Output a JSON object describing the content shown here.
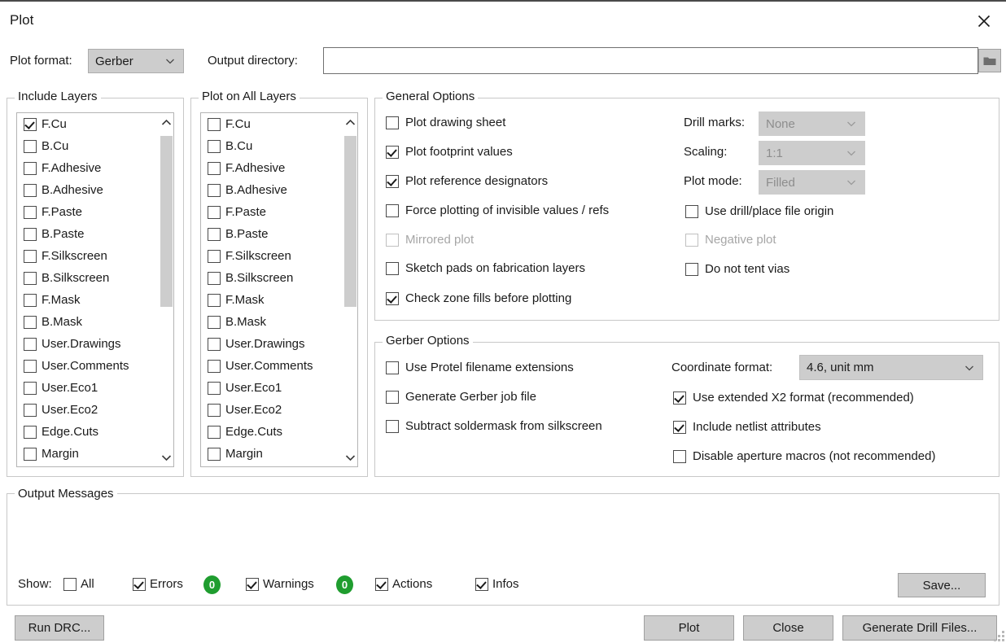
{
  "window": {
    "title": "Plot",
    "close_icon": "close-icon"
  },
  "top": {
    "plot_format_label": "Plot format:",
    "plot_format_value": "Gerber",
    "output_dir_label": "Output directory:",
    "output_dir_value": "",
    "output_dir_placeholder": "",
    "browse_icon": "folder-icon"
  },
  "include_layers": {
    "title": "Include Layers",
    "items": [
      {
        "label": "F.Cu",
        "checked": true
      },
      {
        "label": "B.Cu",
        "checked": false
      },
      {
        "label": "F.Adhesive",
        "checked": false
      },
      {
        "label": "B.Adhesive",
        "checked": false
      },
      {
        "label": "F.Paste",
        "checked": false
      },
      {
        "label": "B.Paste",
        "checked": false
      },
      {
        "label": "F.Silkscreen",
        "checked": false
      },
      {
        "label": "B.Silkscreen",
        "checked": false
      },
      {
        "label": "F.Mask",
        "checked": false
      },
      {
        "label": "B.Mask",
        "checked": false
      },
      {
        "label": "User.Drawings",
        "checked": false
      },
      {
        "label": "User.Comments",
        "checked": false
      },
      {
        "label": "User.Eco1",
        "checked": false
      },
      {
        "label": "User.Eco2",
        "checked": false
      },
      {
        "label": "Edge.Cuts",
        "checked": false
      },
      {
        "label": "Margin",
        "checked": false
      }
    ]
  },
  "plot_on_all_layers": {
    "title": "Plot on All Layers",
    "items": [
      {
        "label": "F.Cu",
        "checked": false
      },
      {
        "label": "B.Cu",
        "checked": false
      },
      {
        "label": "F.Adhesive",
        "checked": false
      },
      {
        "label": "B.Adhesive",
        "checked": false
      },
      {
        "label": "F.Paste",
        "checked": false
      },
      {
        "label": "B.Paste",
        "checked": false
      },
      {
        "label": "F.Silkscreen",
        "checked": false
      },
      {
        "label": "B.Silkscreen",
        "checked": false
      },
      {
        "label": "F.Mask",
        "checked": false
      },
      {
        "label": "B.Mask",
        "checked": false
      },
      {
        "label": "User.Drawings",
        "checked": false
      },
      {
        "label": "User.Comments",
        "checked": false
      },
      {
        "label": "User.Eco1",
        "checked": false
      },
      {
        "label": "User.Eco2",
        "checked": false
      },
      {
        "label": "Edge.Cuts",
        "checked": false
      },
      {
        "label": "Margin",
        "checked": false
      }
    ]
  },
  "general_options": {
    "title": "General Options",
    "checkboxes": [
      {
        "label": "Plot drawing sheet",
        "checked": false,
        "enabled": true
      },
      {
        "label": "Plot footprint values",
        "checked": true,
        "enabled": true
      },
      {
        "label": "Plot reference designators",
        "checked": true,
        "enabled": true
      },
      {
        "label": "Force plotting of invisible values / refs",
        "checked": false,
        "enabled": true
      },
      {
        "label": "Mirrored plot",
        "checked": false,
        "enabled": false
      },
      {
        "label": "Sketch pads on fabrication layers",
        "checked": false,
        "enabled": true
      },
      {
        "label": "Check zone fills before plotting",
        "checked": true,
        "enabled": true
      }
    ],
    "drill_marks_label": "Drill marks:",
    "drill_marks_value": "None",
    "scaling_label": "Scaling:",
    "scaling_value": "1:1",
    "plot_mode_label": "Plot mode:",
    "plot_mode_value": "Filled",
    "right_checkboxes": [
      {
        "label": "Use drill/place file origin",
        "checked": false,
        "enabled": true
      },
      {
        "label": "Negative plot",
        "checked": false,
        "enabled": false
      },
      {
        "label": "Do not tent vias",
        "checked": false,
        "enabled": true
      }
    ]
  },
  "gerber_options": {
    "title": "Gerber Options",
    "checkboxes": [
      {
        "label": "Use Protel filename extensions",
        "checked": false,
        "enabled": true
      },
      {
        "label": "Generate Gerber job file",
        "checked": false,
        "enabled": true
      },
      {
        "label": "Subtract soldermask from silkscreen",
        "checked": false,
        "enabled": true
      }
    ],
    "coordinate_format_label": "Coordinate format:",
    "coordinate_format_value": "4.6, unit mm",
    "right_checkboxes": [
      {
        "label": "Use extended X2 format (recommended)",
        "checked": true,
        "enabled": true
      },
      {
        "label": "Include netlist attributes",
        "checked": true,
        "enabled": true
      },
      {
        "label": "Disable aperture macros (not recommended)",
        "checked": false,
        "enabled": true
      }
    ]
  },
  "output_messages": {
    "title": "Output Messages",
    "show_label": "Show:",
    "filters": [
      {
        "label": "All",
        "checked": false,
        "badge": null
      },
      {
        "label": "Errors",
        "checked": true,
        "badge": "0"
      },
      {
        "label": "Warnings",
        "checked": true,
        "badge": "0"
      },
      {
        "label": "Actions",
        "checked": true,
        "badge": null
      },
      {
        "label": "Infos",
        "checked": true,
        "badge": null
      }
    ],
    "save_button": "Save...",
    "badge_color": "#1f9d2f"
  },
  "footer": {
    "run_drc": "Run DRC...",
    "plot": "Plot",
    "close": "Close",
    "generate_drill_files": "Generate Drill Files..."
  }
}
